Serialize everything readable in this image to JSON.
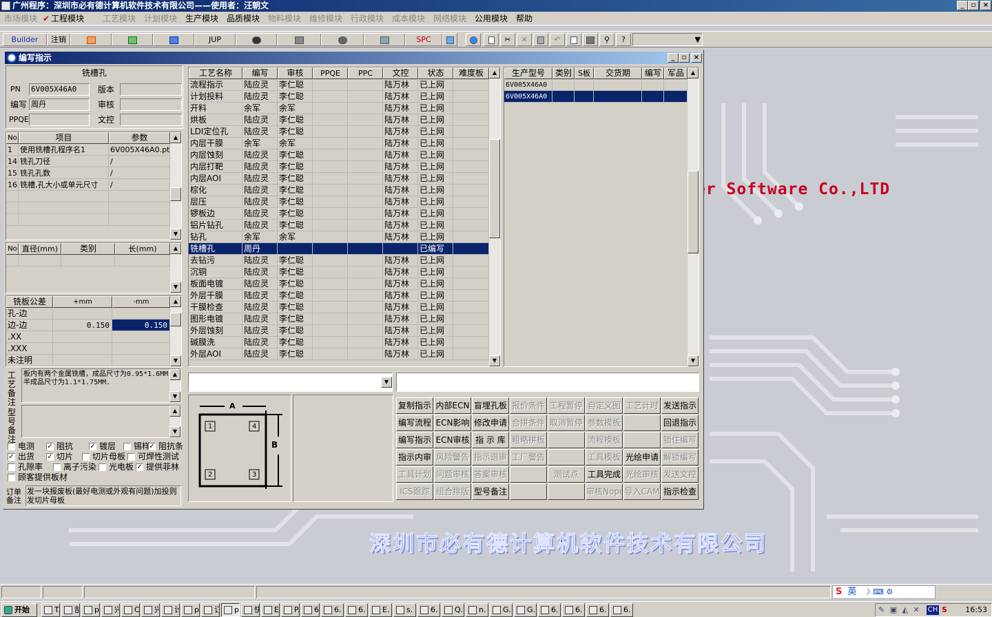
{
  "window": {
    "title": "广州程序：深圳市必有德计算机软件技术有限公司——使用者：汪朝文",
    "controls": [
      "_",
      "▫",
      "×"
    ]
  },
  "menu": [
    {
      "label": "市场模块",
      "enabled": false
    },
    {
      "label": "工程模块",
      "enabled": true,
      "checked": true
    },
    {
      "label": "工艺模块",
      "enabled": false
    },
    {
      "label": "计划模块",
      "enabled": false
    },
    {
      "label": "生产模块",
      "enabled": true
    },
    {
      "label": "品质模块",
      "enabled": true
    },
    {
      "label": "物料模块",
      "enabled": false
    },
    {
      "label": "维修模块",
      "enabled": false
    },
    {
      "label": "行政模块",
      "enabled": false
    },
    {
      "label": "成本模块",
      "enabled": false
    },
    {
      "label": "网络模块",
      "enabled": false
    },
    {
      "label": "公用模块",
      "enabled": true
    },
    {
      "label": "帮助",
      "enabled": true
    }
  ],
  "toolbar": {
    "builder": "Builder",
    "logout": "注销",
    "jup": "JUP",
    "spc": "SPC"
  },
  "background": {
    "slogan": "er Software Co.,LTD",
    "company": "深圳市必有德计算机软件技术有限公司"
  },
  "child": {
    "title": "编写指示",
    "section_title": "铣槽孔",
    "fields": {
      "pn_label": "PN",
      "pn_value": "6V005X46A0",
      "version_label": "版本",
      "version_value": "",
      "author_label": "编写",
      "author_value": "周丹",
      "review_label": "审核",
      "review_value": "",
      "ppqe_label": "PPQE",
      "ppqe_value": "",
      "doc_label": "文控",
      "doc_value": ""
    },
    "items_table": {
      "headers": [
        "No",
        "项目",
        "参数"
      ],
      "rows": [
        [
          "1",
          "使用铣槽孔程序名1",
          "6V005X46A0.pth"
        ],
        [
          "14",
          "铣孔刀径",
          "/"
        ],
        [
          "15",
          "铣孔孔数",
          "/"
        ],
        [
          "16",
          "铣槽,孔大小或单元尺寸",
          "/"
        ]
      ]
    },
    "dia_table": {
      "headers": [
        "No",
        "直径(mm)",
        "类别",
        "长(mm)"
      ]
    },
    "tol_table": {
      "headers": [
        "铣板公差",
        "+mm",
        "-mm"
      ],
      "rows": [
        [
          "孔-边",
          "",
          ""
        ],
        [
          "边-边",
          "0.150",
          "0.150"
        ],
        [
          ".XX",
          "",
          ""
        ],
        [
          ".XXX",
          "",
          ""
        ],
        [
          "未注明",
          "",
          ""
        ]
      ]
    },
    "process_note_label": "工艺备注",
    "process_note": "板内有两个金属铣槽，成品尺寸为0.95*1.6MM.半成品尺寸为1.1*1.75MM.",
    "model_note_label": "型号备注",
    "model_note": "",
    "checkboxes": [
      [
        {
          "label": "电测",
          "checked": false
        },
        {
          "label": "阻抗",
          "checked": true
        },
        {
          "label": "镀层",
          "checked": true
        },
        {
          "label": "锡样",
          "checked": false
        },
        {
          "label": "阻抗条",
          "checked": true
        }
      ],
      [
        {
          "label": "出货",
          "checked": true
        },
        {
          "label": "切片",
          "checked": true
        },
        {
          "label": "切片母板",
          "checked": false
        },
        {
          "label": "可焊性测试",
          "checked": false
        }
      ],
      [
        {
          "label": "孔隙率",
          "checked": false
        },
        {
          "label": "离子污染",
          "checked": false
        },
        {
          "label": "光电板",
          "checked": false
        },
        {
          "label": "提供菲林",
          "checked": true
        }
      ],
      [
        {
          "label": "顾客提供板材",
          "checked": false
        }
      ]
    ],
    "order_note_label": "订单备注",
    "order_note": "发一块报废板(最好电测或外观有问题)加投则发切片母板",
    "process_table": {
      "headers": [
        "工艺名称",
        "编写",
        "审核",
        "PPQE",
        "PPC",
        "文控",
        "状态",
        "难度板"
      ],
      "rows": [
        [
          "流程指示",
          "陆应灵",
          "李仁聪",
          "",
          "",
          "陆万林",
          "已上网",
          ""
        ],
        [
          "计划投料",
          "陆应灵",
          "李仁聪",
          "",
          "",
          "陆万林",
          "已上网",
          ""
        ],
        [
          "开料",
          "余军",
          "余军",
          "",
          "",
          "陆万林",
          "已上网",
          ""
        ],
        [
          "烘板",
          "陆应灵",
          "李仁聪",
          "",
          "",
          "陆万林",
          "已上网",
          ""
        ],
        [
          "LDI定位孔",
          "陆应灵",
          "李仁聪",
          "",
          "",
          "陆万林",
          "已上网",
          ""
        ],
        [
          "内层干膜",
          "余军",
          "余军",
          "",
          "",
          "陆万林",
          "已上网",
          ""
        ],
        [
          "内层蚀刻",
          "陆应灵",
          "李仁聪",
          "",
          "",
          "陆万林",
          "已上网",
          ""
        ],
        [
          "内层打靶",
          "陆应灵",
          "李仁聪",
          "",
          "",
          "陆万林",
          "已上网",
          ""
        ],
        [
          "内层AOI",
          "陆应灵",
          "李仁聪",
          "",
          "",
          "陆万林",
          "已上网",
          ""
        ],
        [
          "棕化",
          "陆应灵",
          "李仁聪",
          "",
          "",
          "陆万林",
          "已上网",
          ""
        ],
        [
          "层压",
          "陆应灵",
          "李仁聪",
          "",
          "",
          "陆万林",
          "已上网",
          ""
        ],
        [
          "锣板边",
          "陆应灵",
          "李仁聪",
          "",
          "",
          "陆万林",
          "已上网",
          ""
        ],
        [
          "铝片钻孔",
          "陆应灵",
          "李仁聪",
          "",
          "",
          "陆万林",
          "已上网",
          ""
        ],
        [
          "钻孔",
          "余军",
          "余军",
          "",
          "",
          "陆万林",
          "已上网",
          ""
        ],
        [
          "铣槽孔",
          "周丹",
          "",
          "",
          "",
          "",
          "已编写",
          ""
        ],
        [
          "去钻污",
          "陆应灵",
          "李仁聪",
          "",
          "",
          "陆万林",
          "已上网",
          ""
        ],
        [
          "沉铜",
          "陆应灵",
          "李仁聪",
          "",
          "",
          "陆万林",
          "已上网",
          ""
        ],
        [
          "板面电镀",
          "陆应灵",
          "李仁聪",
          "",
          "",
          "陆万林",
          "已上网",
          ""
        ],
        [
          "外层干膜",
          "陆应灵",
          "李仁聪",
          "",
          "",
          "陆万林",
          "已上网",
          ""
        ],
        [
          "干膜检查",
          "陆应灵",
          "李仁聪",
          "",
          "",
          "陆万林",
          "已上网",
          ""
        ],
        [
          "图形电镀",
          "陆应灵",
          "李仁聪",
          "",
          "",
          "陆万林",
          "已上网",
          ""
        ],
        [
          "外层蚀刻",
          "陆应灵",
          "李仁聪",
          "",
          "",
          "陆万林",
          "已上网",
          ""
        ],
        [
          "碱膜洗",
          "陆应灵",
          "李仁聪",
          "",
          "",
          "陆万林",
          "已上网",
          ""
        ],
        [
          "外层AOI",
          "陆应灵",
          "李仁聪",
          "",
          "",
          "陆万林",
          "已上网",
          ""
        ]
      ],
      "selected_index": 14
    },
    "model_table": {
      "headers": [
        "生产型号",
        "类别",
        "S板",
        "交货期",
        "编写",
        "军品"
      ],
      "rows": [
        [
          "6V005X46A0",
          "",
          "",
          "",
          "",
          ""
        ],
        [
          "6V005X46A0",
          "",
          "",
          "",
          "",
          ""
        ]
      ],
      "selected_index": 1
    },
    "diagram": {
      "label_a": "A",
      "label_b": "B",
      "slots": [
        "1",
        "4",
        "2",
        "3"
      ]
    },
    "action_buttons": [
      [
        {
          "label": "复制指示",
          "enabled": true
        },
        {
          "label": "内部ECN",
          "enabled": true
        },
        {
          "label": "盲埋孔板",
          "enabled": true
        },
        {
          "label": "报价条件",
          "enabled": false
        },
        {
          "label": "工程暂停",
          "enabled": false
        },
        {
          "label": "自定义图",
          "enabled": false
        },
        {
          "label": "工艺计时",
          "enabled": false
        },
        {
          "label": "发送指示",
          "enabled": true
        }
      ],
      [
        {
          "label": "编写流程",
          "enabled": true
        },
        {
          "label": "ECN影响",
          "enabled": true
        },
        {
          "label": "修改申请",
          "enabled": true
        },
        {
          "label": "合拼条件",
          "enabled": false
        },
        {
          "label": "取消暂停",
          "enabled": false
        },
        {
          "label": "参数模板",
          "enabled": false
        },
        {
          "label": "",
          "enabled": false
        },
        {
          "label": "回退指示",
          "enabled": true
        }
      ],
      [
        {
          "label": "编写指示",
          "enabled": true
        },
        {
          "label": "ECN审核",
          "enabled": true
        },
        {
          "label": "指 示 库",
          "enabled": true
        },
        {
          "label": "粗略拼板",
          "enabled": false
        },
        {
          "label": "",
          "enabled": false
        },
        {
          "label": "流程模板",
          "enabled": false
        },
        {
          "label": "",
          "enabled": false
        },
        {
          "label": "锁住编写",
          "enabled": false
        }
      ],
      [
        {
          "label": "指示内审",
          "enabled": true
        },
        {
          "label": "风险警告",
          "enabled": false
        },
        {
          "label": "指示退审",
          "enabled": false
        },
        {
          "label": "工厂警告",
          "enabled": false
        },
        {
          "label": "",
          "enabled": false
        },
        {
          "label": "工具模板",
          "enabled": false
        },
        {
          "label": "光绘申请",
          "enabled": true
        },
        {
          "label": "解锁编写",
          "enabled": false
        }
      ],
      [
        {
          "label": "工具计划",
          "enabled": false
        },
        {
          "label": "问题审核",
          "enabled": false
        },
        {
          "label": "答案审核",
          "enabled": false
        },
        {
          "label": "",
          "enabled": false
        },
        {
          "label": "测试点",
          "enabled": false
        },
        {
          "label": "工具完成",
          "enabled": true
        },
        {
          "label": "光绘审核",
          "enabled": false
        },
        {
          "label": "发送文控",
          "enabled": false
        }
      ],
      [
        {
          "label": "ICS跟踪",
          "enabled": false
        },
        {
          "label": "组合排版",
          "enabled": false
        },
        {
          "label": "型号备注",
          "enabled": true
        },
        {
          "label": "",
          "enabled": false
        },
        {
          "label": "",
          "enabled": false
        },
        {
          "label": "审核Nope",
          "enabled": false
        },
        {
          "label": "导入CAM",
          "enabled": false
        },
        {
          "label": "指示检查",
          "enabled": true
        }
      ]
    ]
  },
  "taskbar": {
    "start": "开始",
    "items": [
      "T.",
      "部",
      "p.",
      "兴",
      "C.",
      "兴",
      "计",
      "p.",
      "订",
      "p.",
      "快",
      "E.",
      "P.",
      "6.",
      "6.",
      "6.",
      "E.",
      "s.",
      "6.",
      "Q.",
      "n.",
      "G.",
      "G.",
      "6.",
      "6.",
      "6.",
      "6."
    ],
    "ime": "英",
    "lang": "CH",
    "clock": "16:53"
  }
}
